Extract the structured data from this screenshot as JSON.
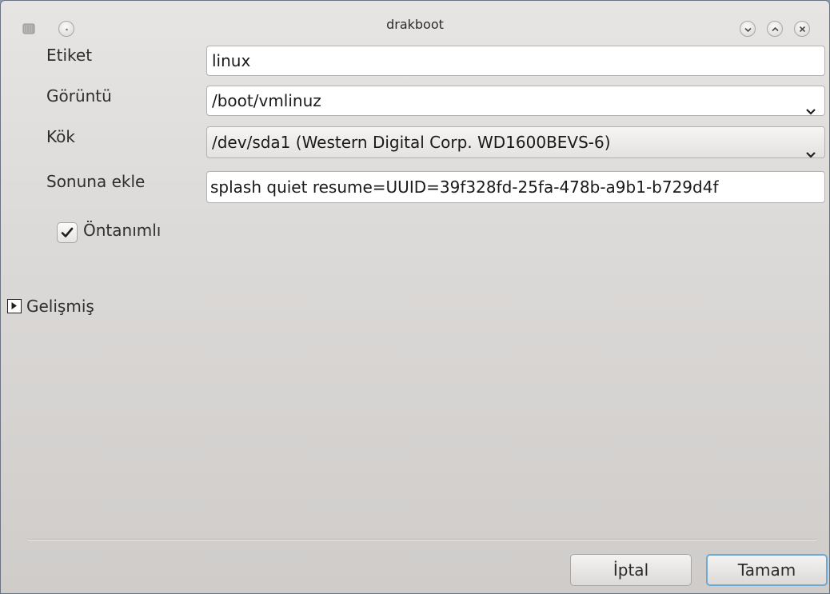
{
  "window": {
    "title": "drakboot"
  },
  "form": {
    "label_field": {
      "label": "Etiket",
      "value": "linux"
    },
    "image_field": {
      "label": "Görüntü",
      "value": "/boot/vmlinuz"
    },
    "root_field": {
      "label": "Kök",
      "value": "/dev/sda1 (Western Digital Corp. WD1600BEVS-6)"
    },
    "append_field": {
      "label": "Sonuna ekle",
      "value": "splash quiet resume=UUID=39f328fd-25fa-478b-a9b1-b729d4f"
    },
    "default_checkbox": {
      "label": "Öntanımlı",
      "checked": true
    },
    "advanced_expander": {
      "label": "Gelişmiş",
      "expanded": false
    }
  },
  "buttons": {
    "cancel_label": "İptal",
    "ok_label": "Tamam"
  },
  "icons": {
    "app": "hard-disk-icon",
    "menu": "window-menu-icon",
    "minimize": "minimize-icon",
    "maximize": "maximize-icon",
    "close": "close-icon",
    "dropdown": "chevron-down-icon",
    "check": "checkmark-icon",
    "expander": "triangle-right-icon"
  },
  "colors": {
    "default_button_border": "#6ea8d4",
    "window_background": "#dcdad8"
  }
}
